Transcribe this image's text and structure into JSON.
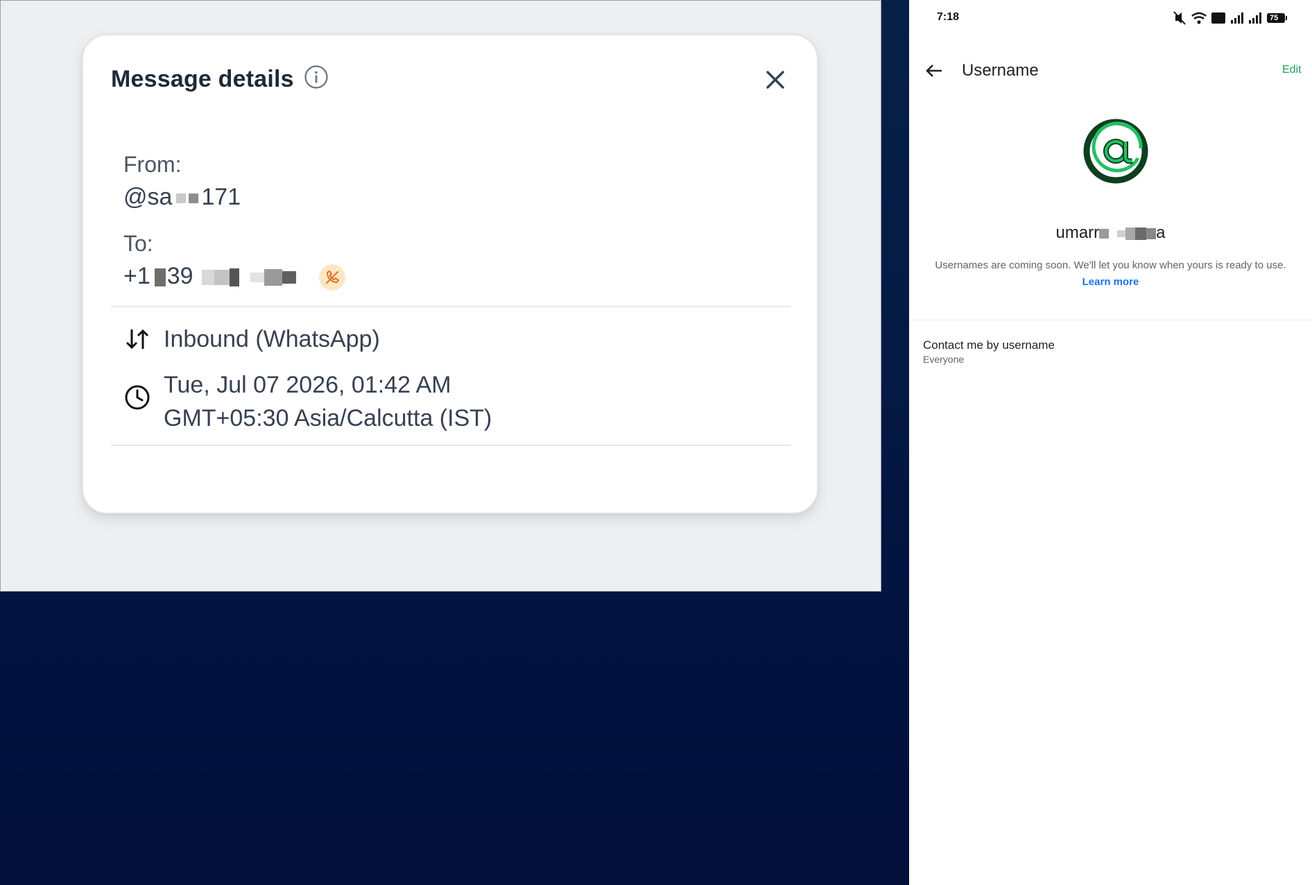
{
  "modal": {
    "title": "Message details",
    "from_label": "From:",
    "from_prefix": "@sa",
    "from_suffix": "171",
    "to_label": "To:",
    "to_prefix": "+1",
    "to_mid": "39",
    "direction": "Inbound (WhatsApp)",
    "datetime_line1": "Tue, Jul 07 2026, 01:42 AM",
    "datetime_line2": "GMT+05:30 Asia/Calcutta (IST)"
  },
  "phone": {
    "status_time": "7:18",
    "battery": "75",
    "app_title": "Username",
    "edit_label": "Edit",
    "username_prefix": "umarr",
    "username_suffix": "a",
    "description": "Usernames are coming soon. We'll let you know when yours is ready to use.",
    "learn_more": "Learn more",
    "setting_title": "Contact me by username",
    "setting_value": "Everyone"
  },
  "colors": {
    "accent_green": "#1e9e5a",
    "link_blue": "#1a73e8",
    "call_badge": "#fde7c4"
  }
}
